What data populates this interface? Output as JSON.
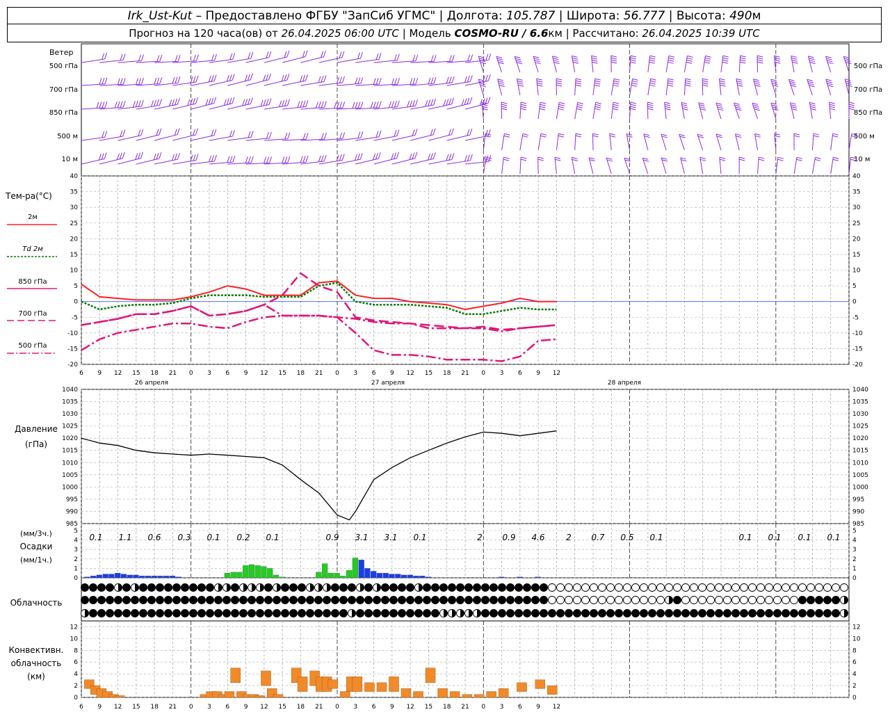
{
  "header": {
    "station": "Irk_Ust-Kut",
    "provider": "– Предоставлено ФГБУ \"ЗапСиб УГМС\"",
    "lon_label": "| Долгота:",
    "lon_value": "105.787",
    "lat_label": "| Широта:",
    "lat_value": "56.777",
    "alt_label": "| Высота:",
    "alt_value": "490",
    "alt_unit": "м",
    "forecast_label": "Прогноз на 120 часа(ов) от",
    "forecast_start": "26.04.2025 06:00 UTC",
    "model_label": "| Модель",
    "model_name": "COSMO-RU / 6.6",
    "model_unit": "км",
    "calc_label": "| Рассчитано:",
    "calc_time": "26.04.2025 10:39 UTC"
  },
  "wind_panel": {
    "title": "Ветер",
    "levels": [
      "500 гПа",
      "700 гПа",
      "850 гПа",
      "500 м",
      "10 м"
    ],
    "right_levels": [
      "500 гПа",
      "700 гПа",
      "850 гПа",
      "500 м",
      "10 м"
    ]
  },
  "temp_panel": {
    "title": "Тем-ра(°С)",
    "legend": [
      "2м",
      "Td 2м",
      "850 гПа",
      "700 гПа",
      "500 гПа"
    ],
    "y_ticks": [
      "40",
      "35",
      "30",
      "25",
      "20",
      "15",
      "10",
      "5",
      "0",
      "-5",
      "-10",
      "-15",
      "-20"
    ]
  },
  "pressure_panel": {
    "title": "Давление",
    "unit": "(гПа)",
    "y_ticks": [
      "1040",
      "1035",
      "1030",
      "1025",
      "1020",
      "1015",
      "1010",
      "1005",
      "1000",
      "995",
      "990",
      "985"
    ]
  },
  "precip_panel": {
    "unit_3h": "(мм/3ч.)",
    "title": "Осадки",
    "unit_1h": "(мм/1ч.)",
    "y_ticks": [
      "5",
      "4",
      "3",
      "2",
      "1",
      "0"
    ],
    "totals_3h": [
      "0.1",
      "1.1",
      "0.6",
      "0.3",
      "0.1",
      "0.2",
      "0.1",
      "0.9",
      "3.1",
      "3.1",
      "0.1",
      "2",
      "0.9",
      "4.6",
      "2",
      "0.7",
      "0.5",
      "0.1",
      "0.1",
      "0.1",
      "0.1",
      "0.1"
    ]
  },
  "cloud_panel": {
    "title": "Облачность"
  },
  "conv_panel": {
    "title_1": "Конвективн.",
    "title_2": "облачность",
    "unit": "(км)",
    "y_ticks": [
      "12",
      "10",
      "8",
      "6",
      "4",
      "2",
      "0"
    ]
  },
  "x_axis": {
    "hour_ticks": [
      "6",
      "9",
      "12",
      "15",
      "18",
      "21",
      "0",
      "3",
      "6",
      "9",
      "12",
      "15",
      "18",
      "21",
      "0",
      "3",
      "6",
      "9",
      "12",
      "15",
      "18",
      "21",
      "0",
      "3",
      "6",
      "9",
      "12"
    ],
    "day_labels": [
      "26 апреля",
      "27 апреля",
      "28 апреля"
    ]
  },
  "colors": {
    "wind": "#8a2be2",
    "t2m": "#ff2020",
    "td2m": "#007a00",
    "t850": "#e0157a",
    "precip_rain": "#22cc22",
    "precip_snow": "#1a3ee8",
    "conv": "#f08a2a"
  },
  "chart_data": [
    {
      "type": "line",
      "title": "Тем-ра(°С)",
      "ylim": [
        -20,
        40
      ],
      "x": [
        "26.04 06",
        "26.04 09",
        "26.04 12",
        "26.04 15",
        "26.04 18",
        "26.04 21",
        "27.04 00",
        "27.04 03",
        "27.04 06",
        "27.04 09",
        "27.04 12",
        "27.04 15",
        "27.04 18",
        "27.04 21",
        "28.04 00",
        "28.04 03",
        "28.04 06",
        "28.04 09",
        "28.04 12",
        "28.04 15",
        "28.04 18",
        "28.04 21",
        "29.04 00",
        "29.04 03",
        "29.04 06",
        "29.04 09",
        "29.04 12"
      ],
      "series": [
        {
          "name": "2м",
          "values": [
            5.5,
            1.5,
            1,
            0.5,
            0.5,
            0.5,
            1.5,
            3,
            5,
            4,
            2,
            2,
            2,
            6,
            6.5,
            2,
            1,
            1,
            0,
            -0.5,
            -1,
            -2.5,
            -1.5,
            -0.5,
            1,
            0,
            0
          ]
        },
        {
          "name": "Td 2м",
          "values": [
            0,
            -2.5,
            -1.5,
            -1,
            -1,
            -0.5,
            1,
            2,
            2,
            2,
            1.5,
            1.5,
            1.5,
            5,
            6,
            0,
            -1,
            -1,
            -1,
            -1.5,
            -2,
            -4,
            -4,
            -3,
            -2,
            -2.5,
            -2.5
          ]
        },
        {
          "name": "850 гПа",
          "values": [
            -7.5,
            -6.5,
            -5.5,
            -4,
            -4,
            -3,
            -1.5,
            -4.5,
            -4,
            -3,
            -1,
            2,
            9,
            5,
            3,
            -5,
            -6,
            -6.5,
            -7,
            -7.5,
            -8,
            -8.5,
            -8,
            -9,
            -8.5,
            -8,
            -7.5
          ]
        },
        {
          "name": "700 гПа",
          "values": [
            -7.5,
            -6.5,
            -5.5,
            -4,
            -4,
            -3,
            -1.5,
            -4.5,
            -4,
            -3,
            -1,
            -4.5,
            -4.5,
            -4.5,
            -5,
            -5.5,
            -6.5,
            -7,
            -7,
            -8.5,
            -8.5,
            -8.5,
            -8.5,
            -9.5,
            -8.5,
            -8,
            -7.5
          ]
        },
        {
          "name": "500 гПа",
          "values": [
            -15.5,
            -12,
            -10,
            -9,
            -8,
            -7,
            -7,
            -8,
            -8.5,
            -6.5,
            -5,
            -4.5,
            -4.5,
            -4.5,
            -5,
            -10,
            -15.5,
            -17,
            -17,
            -17.5,
            -18.5,
            -18.5,
            -18.5,
            -19,
            -17.5,
            -12.5,
            -12
          ]
        }
      ]
    },
    {
      "type": "line",
      "title": "Давление",
      "ylabel": "(гПа)",
      "ylim": [
        985,
        1040
      ],
      "x": [
        "26.04 06",
        "26.04 09",
        "26.04 12",
        "26.04 15",
        "26.04 18",
        "26.04 21",
        "27.04 00",
        "27.04 03",
        "27.04 06",
        "27.04 09",
        "27.04 12",
        "27.04 15",
        "27.04 18",
        "27.04 21",
        "28.04 00",
        "28.04 02",
        "28.04 03",
        "28.04 06",
        "28.04 09",
        "28.04 12",
        "28.04 15",
        "28.04 18",
        "28.04 21",
        "29.04 00",
        "29.04 03",
        "29.04 06",
        "29.04 09",
        "29.04 12"
      ],
      "values": [
        1020,
        1018,
        1017,
        1015,
        1014,
        1013.5,
        1013,
        1013.5,
        1013,
        1012.5,
        1012,
        1009,
        1003,
        997.5,
        988.5,
        986.5,
        990,
        1003,
        1008,
        1012,
        1015,
        1018,
        1020.5,
        1022.5,
        1022,
        1021,
        1022,
        1023
      ]
    },
    {
      "type": "bar",
      "title": "Осадки",
      "ylabel": "(мм/1ч.)",
      "ylim": [
        0,
        5
      ],
      "x": [
        "26.04 07",
        "26.04 08",
        "26.04 09",
        "26.04 10",
        "26.04 11",
        "26.04 12",
        "26.04 13",
        "26.04 14",
        "26.04 15",
        "26.04 16",
        "26.04 17",
        "26.04 18",
        "26.04 19",
        "26.04 20",
        "26.04 21",
        "26.04 22",
        "27.04 06",
        "27.04 07",
        "27.04 08",
        "27.04 09",
        "27.04 10",
        "27.04 11",
        "27.04 12",
        "27.04 13",
        "27.04 14",
        "27.04 15",
        "27.04 21",
        "27.04 22",
        "27.04 23",
        "28.04 00",
        "28.04 01",
        "28.04 02",
        "28.04 03",
        "28.04 04",
        "28.04 05",
        "28.04 06",
        "28.04 07",
        "28.04 08",
        "28.04 09",
        "28.04 10",
        "28.04 11",
        "28.04 12",
        "28.04 13",
        "28.04 14",
        "28.04 15",
        "29.04 03",
        "29.04 06",
        "29.04 09"
      ],
      "values": [
        0.1,
        0.2,
        0.3,
        0.4,
        0.4,
        0.5,
        0.4,
        0.3,
        0.3,
        0.2,
        0.2,
        0.2,
        0.2,
        0.2,
        0.2,
        0.1,
        0.5,
        0.6,
        0.6,
        1.3,
        1.4,
        1.3,
        1.2,
        1.0,
        0.3,
        0.1,
        0.6,
        1.5,
        0.5,
        0.5,
        0.2,
        0.8,
        2.1,
        1.9,
        1.0,
        0.7,
        0.5,
        0.5,
        0.4,
        0.4,
        0.3,
        0.3,
        0.2,
        0.2,
        0.1,
        0.1,
        0.1,
        0.1
      ]
    },
    {
      "type": "bar",
      "title": "Конвективн. облачность",
      "ylabel": "(км)",
      "ylim": [
        0,
        12
      ],
      "x": [
        "26.04 07",
        "26.04 08",
        "26.04 09",
        "26.04 10",
        "26.04 11",
        "26.04 12",
        "27.04 02",
        "27.04 03",
        "27.04 04",
        "27.04 05",
        "27.04 06",
        "27.04 07",
        "27.04 08",
        "27.04 09",
        "27.04 10",
        "27.04 11",
        "27.04 12",
        "27.04 13",
        "27.04 14",
        "27.04 17",
        "27.04 18",
        "27.04 20",
        "27.04 21",
        "27.04 22",
        "27.04 23",
        "28.04 01",
        "28.04 02",
        "28.04 03",
        "28.04 05",
        "28.04 07",
        "28.04 09",
        "28.04 11",
        "28.04 13",
        "28.04 15",
        "28.04 17",
        "28.04 19",
        "28.04 21",
        "28.04 23",
        "29.04 01",
        "29.04 03",
        "29.04 06",
        "29.04 09",
        "29.04 11"
      ],
      "values": [
        3,
        2,
        1.5,
        1,
        0.5,
        0.3,
        0.5,
        1,
        1,
        0.5,
        1,
        5,
        1,
        0.5,
        0.5,
        0.3,
        4.5,
        1.5,
        0.5,
        5,
        3.5,
        4.5,
        3.5,
        3.5,
        3,
        1,
        3.5,
        3.5,
        2.5,
        2.5,
        3.5,
        1.5,
        1,
        5,
        1.5,
        1,
        0.5,
        0.5,
        1,
        1.5,
        2.5,
        3,
        2
      ]
    }
  ]
}
